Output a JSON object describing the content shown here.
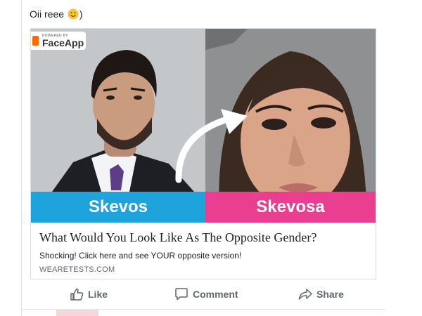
{
  "post": {
    "text": "Oii reee",
    "emoji_suffix": ")",
    "emoji_icon": "smiley-face-icon"
  },
  "card": {
    "badge": {
      "small": "POWERED BY",
      "main": "FaceApp"
    },
    "left_name": "Skevos",
    "right_name": "Skevosa",
    "headline": "What Would You Look Like As The Opposite Gender?",
    "description": "Shocking! Click here and see YOUR opposite version!",
    "domain": "WEARETESTS.COM",
    "colors": {
      "left_band": "#1fa3dc",
      "right_band": "#ea3e91"
    }
  },
  "actions": {
    "like": "Like",
    "comment": "Comment",
    "share": "Share"
  }
}
